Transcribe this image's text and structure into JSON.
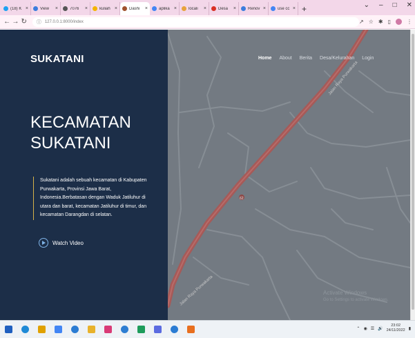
{
  "browser": {
    "tabs": [
      {
        "title": "(18) K",
        "color": "#1da1f2"
      },
      {
        "title": "View",
        "color": "#3b7ddd"
      },
      {
        "title": "7076",
        "color": "#555555"
      },
      {
        "title": "kuliah",
        "color": "#f4b400"
      },
      {
        "title": "Dashi",
        "color": "#a0522d"
      },
      {
        "title": "aplika",
        "color": "#4285f4"
      },
      {
        "title": "locali",
        "color": "#e8a33b"
      },
      {
        "title": "Desa",
        "color": "#d93025"
      },
      {
        "title": "Renov",
        "color": "#3b7ddd"
      },
      {
        "title": "use cc",
        "color": "#4285f4"
      }
    ],
    "new_tab": "+",
    "url": "127.0.0.1:8000/index"
  },
  "page": {
    "brand": "SUKATANI",
    "nav": [
      "Home",
      "About",
      "Berita",
      "Desa/Kelurahan",
      "Login"
    ],
    "hero_title_line1": "KECAMATAN",
    "hero_title_line2": "SUKATANI",
    "hero_description": "Sukatani adalah sebuah kecamatan di Kabupaten Purwakarta, Provinsi Jawa Barat, Indonesia.Berbatasan dengan Waduk Jatiluhur di utara dan barat, kecamatan Jatiluhur di timur, dan kecamatan Darangdan di selatan.",
    "watch_video": "Watch Video",
    "map_road_label": "Jalan Raya Purwakarta",
    "map_road_number": "62",
    "activate_title": "Activate Windows",
    "activate_sub": "Go to Settings to activate Windows."
  },
  "taskbar": {
    "icons": [
      "windows-start",
      "cortana",
      "chrome",
      "search",
      "task-view",
      "file-explorer",
      "paint",
      "store",
      "spreadsheet",
      "mail",
      "vscode",
      "xampp"
    ],
    "icon_colors": [
      "#1f5fbf",
      "#1f8ad6",
      "#e0a100",
      "#4285f4",
      "#2b7cd3",
      "#e8b22b",
      "#d93a76",
      "#2d7dd2",
      "#1e9c5b",
      "#5b6be0",
      "#2b7cd3",
      "#e86f1f"
    ],
    "time": "23:02",
    "date": "24/11/2022"
  },
  "colors": {
    "panel": "#1c2e48",
    "map_bg": "#737a82",
    "road": "#a65a58",
    "accent": "#d6b34a"
  }
}
